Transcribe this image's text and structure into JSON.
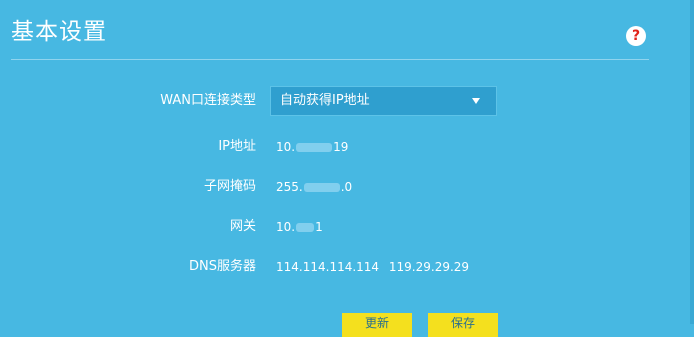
{
  "header": {
    "title": "基本设置",
    "help_icon": "?"
  },
  "form": {
    "wan_type": {
      "label": "WAN口连接类型",
      "selected": "自动获得IP地址"
    },
    "ip": {
      "label": "IP地址",
      "prefix": "10.",
      "suffix": "19"
    },
    "subnet": {
      "label": "子网掩码",
      "prefix": "255.",
      "suffix": ".0"
    },
    "gateway": {
      "label": "网关",
      "prefix": "10.",
      "suffix": "1"
    },
    "dns": {
      "label": "DNS服务器",
      "primary": "114.114.114.114",
      "secondary": "119.29.29.29"
    }
  },
  "buttons": {
    "renew_label": "更新",
    "save_label": "保存"
  },
  "colors": {
    "background": "#47b8e2",
    "select_bg": "#2f9fcf",
    "button_bg": "#f4e01e",
    "help_icon": "#e2231a"
  }
}
